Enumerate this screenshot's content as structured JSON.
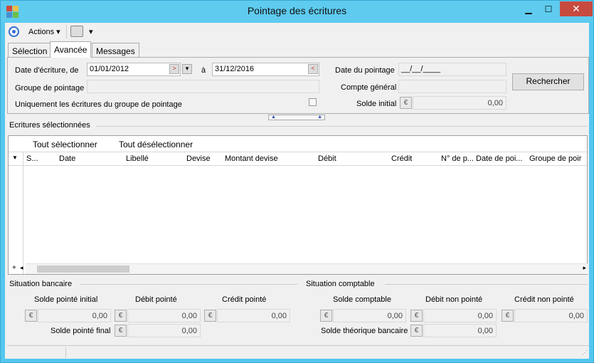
{
  "window": {
    "title": "Pointage des écritures",
    "minimize": "▁",
    "maximize": "☐",
    "close": "✕"
  },
  "toolbar": {
    "actions_label": "Actions"
  },
  "tabs": [
    {
      "label": "Sélection"
    },
    {
      "label": "Avancée"
    },
    {
      "label": "Messages"
    }
  ],
  "filters": {
    "date_label": "Date d'écriture, de",
    "date_from": "01/01/2012",
    "a_label": "à",
    "date_to": "31/12/2016",
    "groupe_label": "Groupe de pointage",
    "groupe_value": "",
    "uniquement_label": "Uniquement les écritures du groupe de pointage",
    "date_pointage_label": "Date du pointage",
    "date_pointage_value": "__/__/____",
    "compte_label": "Compte général",
    "compte_value": "",
    "solde_initial_label": "Solde initial",
    "solde_initial_value": "0,00",
    "rechercher_label": "Rechercher"
  },
  "ecritures": {
    "title": "Ecritures sélectionnées",
    "tout_selectionner": "Tout sélectionner",
    "tout_deselectionner": "Tout désélectionner",
    "columns": [
      "S...",
      "Date",
      "Libellé",
      "Devise",
      "Montant devise",
      "Débit",
      "Crédit",
      "N° de p...",
      "Date de poi...",
      "Groupe de poir"
    ]
  },
  "bancaire": {
    "title": "Situation bancaire",
    "solde_pointe_initial": "Solde pointé initial",
    "debit_pointe": "Débit  pointé",
    "credit_pointe": "Crédit pointé",
    "solde_pointe_final": "Solde pointé final",
    "v_solde_initial": "0,00",
    "v_debit": "0,00",
    "v_credit": "0,00",
    "v_solde_final": "0,00"
  },
  "comptable": {
    "title": "Situation comptable",
    "solde_comptable": "Solde comptable",
    "debit_non_pointe": "Débit non pointé",
    "credit_non_pointe": "Crédit non pointé",
    "solde_theorique": "Solde théorique bancaire",
    "v_solde_comptable": "0,00",
    "v_debit": "0,00",
    "v_credit": "0,00",
    "v_solde_theorique": "0,00"
  },
  "euro": "€"
}
